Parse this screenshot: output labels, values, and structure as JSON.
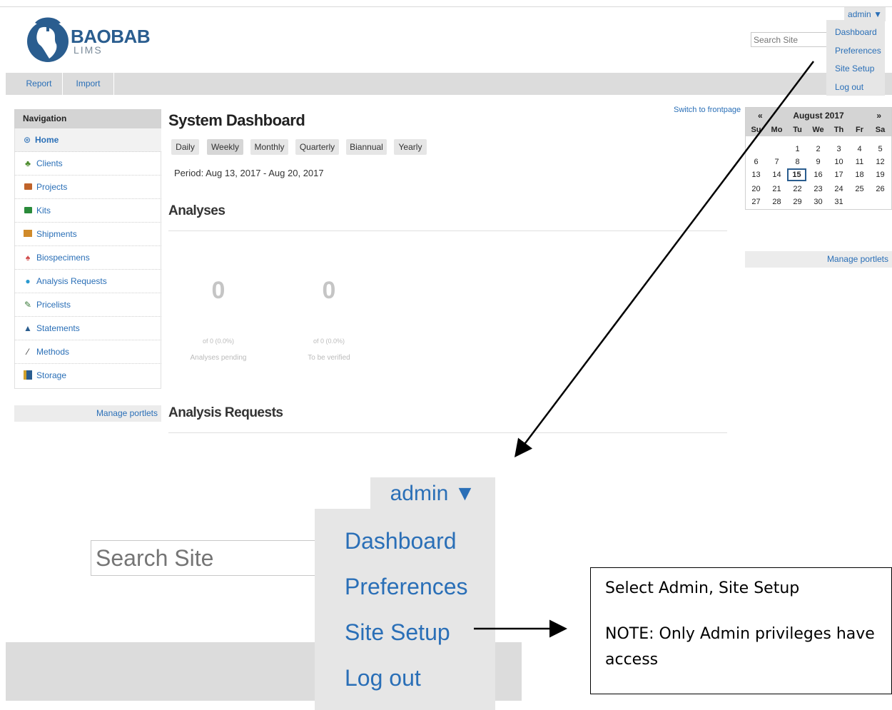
{
  "logo": {
    "name": "BAOBAB",
    "sub": "LIMS"
  },
  "search": {
    "placeholder": "Search Site"
  },
  "user_menu": {
    "label": "admin ▼",
    "items": [
      "Dashboard",
      "Preferences",
      "Site Setup",
      "Log out"
    ]
  },
  "tabs": [
    "Report",
    "Import"
  ],
  "navigation": {
    "title": "Navigation",
    "items": [
      {
        "label": "Home",
        "icon": "home-icon"
      },
      {
        "label": "Clients",
        "icon": "clients-icon"
      },
      {
        "label": "Projects",
        "icon": "projects-icon"
      },
      {
        "label": "Kits",
        "icon": "kits-icon"
      },
      {
        "label": "Shipments",
        "icon": "shipments-icon"
      },
      {
        "label": "Biospecimens",
        "icon": "biospecimens-icon"
      },
      {
        "label": "Analysis Requests",
        "icon": "analysis-requests-icon"
      },
      {
        "label": "Pricelists",
        "icon": "pricelists-icon"
      },
      {
        "label": "Statements",
        "icon": "statements-icon"
      },
      {
        "label": "Methods",
        "icon": "methods-icon"
      },
      {
        "label": "Storage",
        "icon": "storage-icon"
      }
    ],
    "manage": "Manage portlets"
  },
  "main": {
    "switch_front": "Switch to frontpage",
    "title": "System Dashboard",
    "periods": [
      "Daily",
      "Weekly",
      "Monthly",
      "Quarterly",
      "Biannual",
      "Yearly"
    ],
    "selected_period": "Weekly",
    "period_text": "Period:  Aug 13, 2017 -  Aug 20, 2017",
    "analyses_title": "Analyses",
    "stats": [
      {
        "value": "0",
        "sub": "of 0 (0.0%)",
        "label": "Analyses pending"
      },
      {
        "value": "0",
        "sub": "of 0 (0.0%)",
        "label": "To be verified"
      }
    ],
    "ar_title": "Analysis Requests"
  },
  "calendar": {
    "prev": "«",
    "next": "»",
    "month": "August 2017",
    "days": [
      "Su",
      "Mo",
      "Tu",
      "We",
      "Th",
      "Fr",
      "Sa"
    ],
    "weeks": [
      [
        "",
        "",
        "1",
        "2",
        "3",
        "4",
        "5"
      ],
      [
        "6",
        "7",
        "8",
        "9",
        "10",
        "11",
        "12"
      ],
      [
        "13",
        "14",
        "15",
        "16",
        "17",
        "18",
        "19"
      ],
      [
        "20",
        "21",
        "22",
        "23",
        "24",
        "25",
        "26"
      ],
      [
        "27",
        "28",
        "29",
        "30",
        "31",
        "",
        ""
      ]
    ],
    "today": "15",
    "manage": "Manage portlets"
  },
  "callout": {
    "line1": "Select Admin, Site Setup",
    "line2": "NOTE: Only Admin privileges have",
    "line3": "access"
  }
}
